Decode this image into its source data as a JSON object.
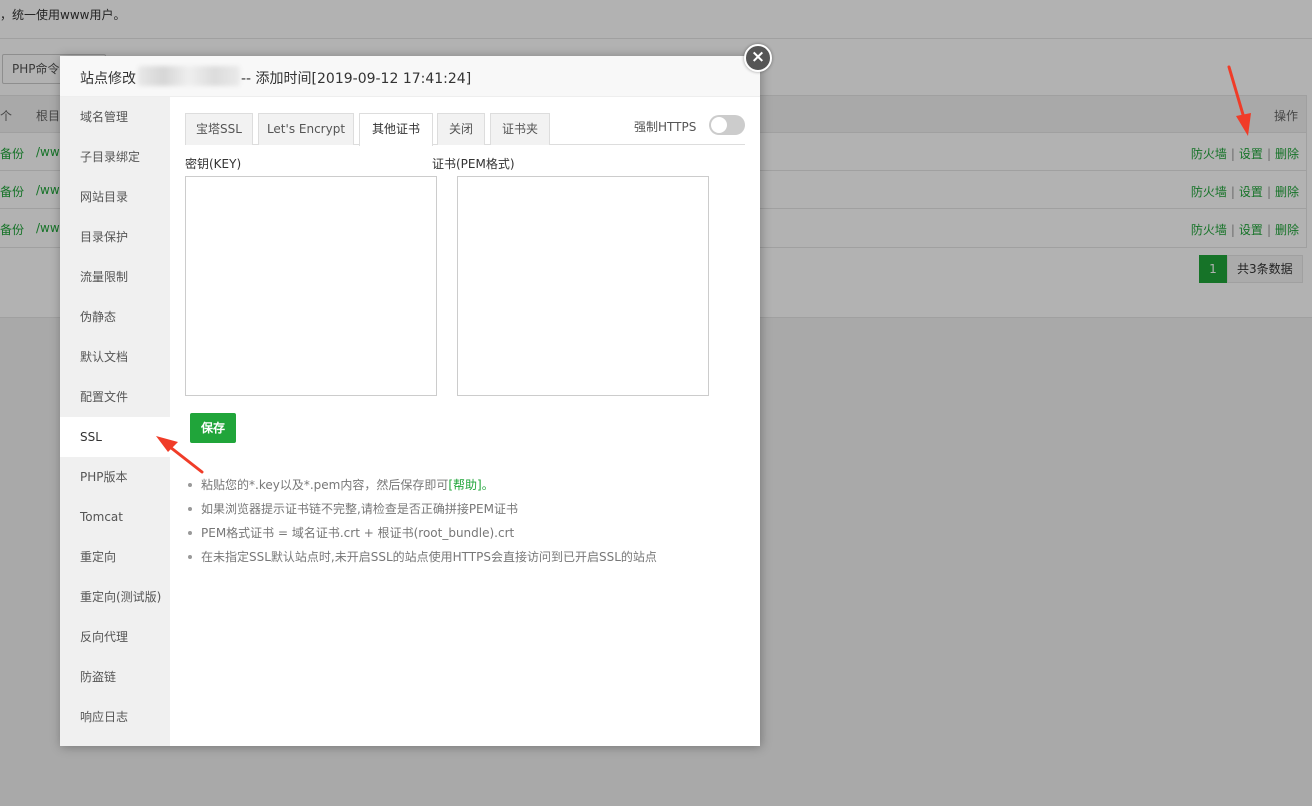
{
  "background": {
    "notice": "，统一使用www用户。",
    "php_button": "PHP命令行",
    "table": {
      "header": {
        "col_left": "个",
        "col_root": "根目",
        "col_ops": "操作"
      },
      "rows": [
        {
          "col_a": "备份",
          "col_b": "/ww",
          "ops": [
            "防火墙",
            "设置",
            "删除"
          ]
        },
        {
          "col_a": "备份",
          "col_b": "/ww",
          "ops": [
            "防火墙",
            "设置",
            "删除"
          ]
        },
        {
          "col_a": "备份",
          "col_b": "/ww",
          "ops": [
            "防火墙",
            "设置",
            "删除"
          ]
        }
      ],
      "separator": "|"
    },
    "pager": {
      "current_page": "1",
      "total": "共3条数据"
    }
  },
  "modal": {
    "title_prefix": "站点修改",
    "title_suffix": "-- 添加时间[2019-09-12 17:41:24]",
    "close_icon": "×",
    "sidebar": {
      "items": [
        {
          "label": "域名管理"
        },
        {
          "label": "子目录绑定"
        },
        {
          "label": "网站目录"
        },
        {
          "label": "目录保护"
        },
        {
          "label": "流量限制"
        },
        {
          "label": "伪静态"
        },
        {
          "label": "默认文档"
        },
        {
          "label": "配置文件"
        },
        {
          "label": "SSL",
          "active": true
        },
        {
          "label": "PHP版本"
        },
        {
          "label": "Tomcat"
        },
        {
          "label": "重定向"
        },
        {
          "label": "重定向(测试版)"
        },
        {
          "label": "反向代理"
        },
        {
          "label": "防盗链"
        },
        {
          "label": "响应日志"
        }
      ]
    },
    "tabs": [
      {
        "label": "宝塔SSL"
      },
      {
        "label": "Let's Encrypt"
      },
      {
        "label": "其他证书",
        "active": true
      },
      {
        "label": "关闭"
      },
      {
        "label": "证书夹"
      }
    ],
    "force_https": {
      "label": "强制HTTPS",
      "enabled": false
    },
    "key_label": "密钥(KEY)",
    "key_value": "",
    "cert_label": "证书(PEM格式)",
    "cert_value": "",
    "save_label": "保存",
    "tips": {
      "tip1_text": "粘贴您的*.key以及*.pem内容，然后保存即可",
      "tip1_help": "[帮助]",
      "tip1_end": "。",
      "tip2": "如果浏览器提示证书链不完整,请检查是否正确拼接PEM证书",
      "tip3": "PEM格式证书 = 域名证书.crt + 根证书(root_bundle).crt",
      "tip4": "在未指定SSL默认站点时,未开启SSL的站点使用HTTPS会直接访问到已开启SSL的站点"
    }
  },
  "colors": {
    "accent": "#20a53a",
    "annotation_arrow": "#f03c28"
  }
}
